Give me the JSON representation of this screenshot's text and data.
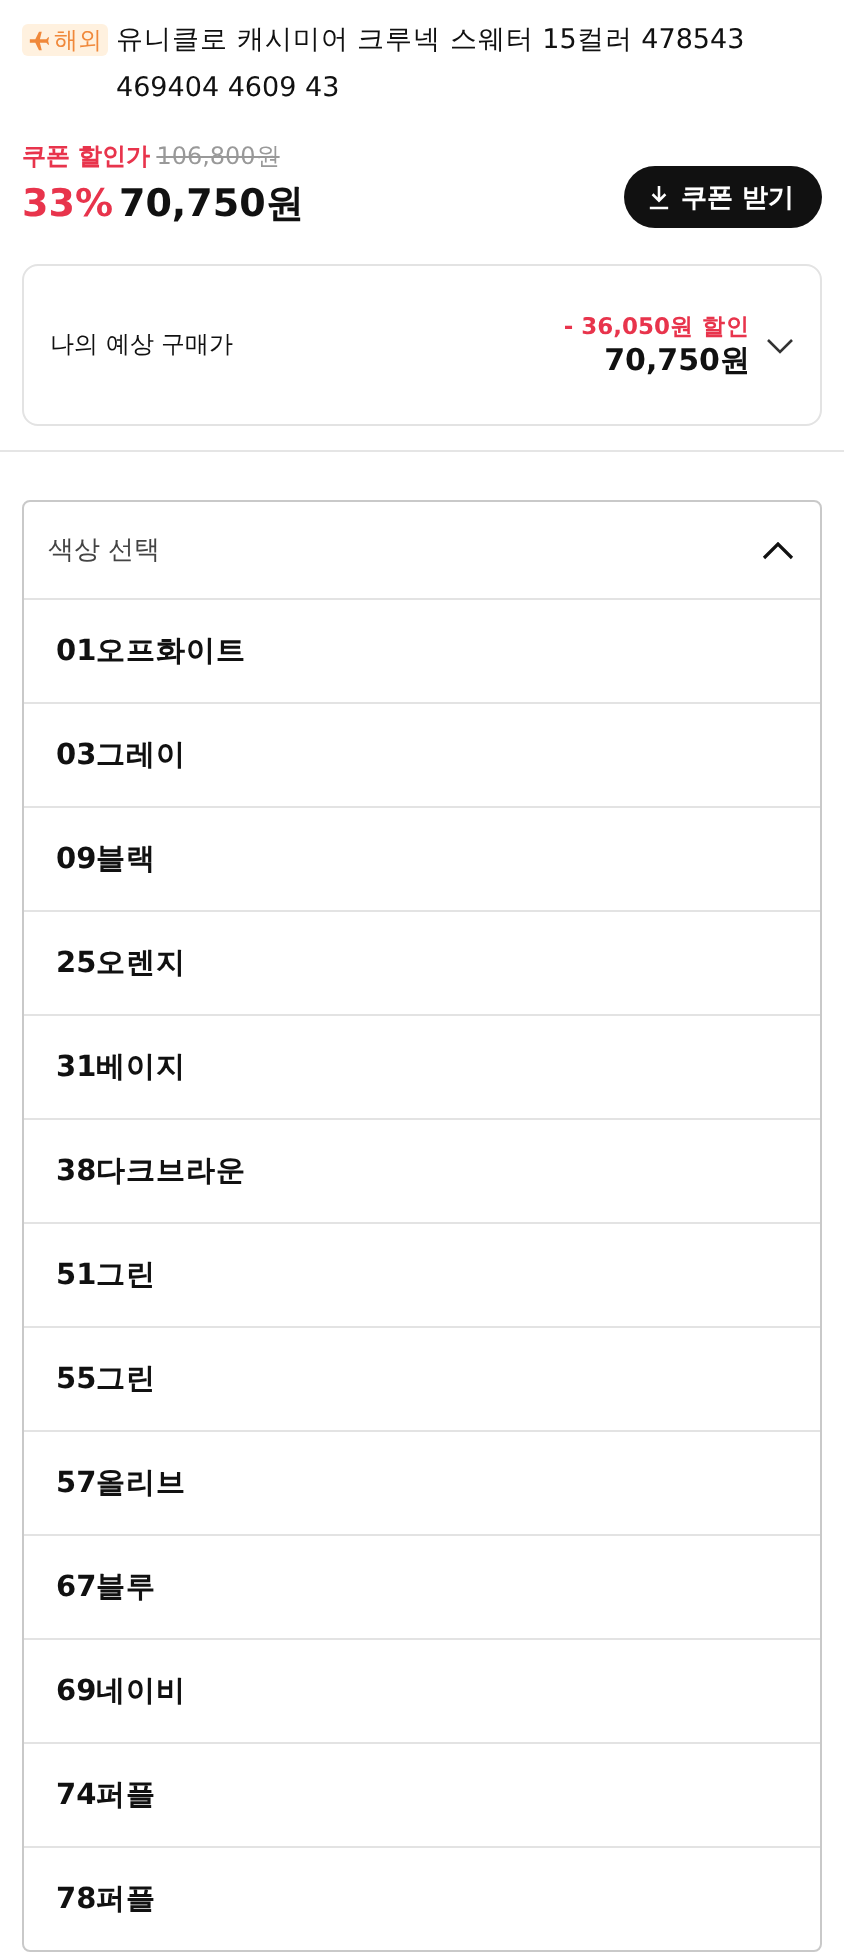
{
  "product": {
    "badge": "해외",
    "title": "유니클로 캐시미어 크루넥 스웨터 15컬러 478543 469404 4609 43"
  },
  "price": {
    "coupon_label": "쿠폰 할인가",
    "original": "106,800원",
    "discount": "33%",
    "final": "70,750원",
    "coupon_button": "쿠폰 받기"
  },
  "estimate": {
    "label": "나의 예상 구매가",
    "discount": "- 36,050원 할인",
    "price": "70,750원",
    "expanded": false
  },
  "color_select": {
    "label": "색상 선택",
    "expanded": true,
    "options": [
      {
        "label": "01오프화이트"
      },
      {
        "label": "03그레이"
      },
      {
        "label": "09블랙"
      },
      {
        "label": "25오렌지"
      },
      {
        "label": "31베이지"
      },
      {
        "label": "38다크브라운"
      },
      {
        "label": "51그린"
      },
      {
        "label": "55그린"
      },
      {
        "label": "57올리브"
      },
      {
        "label": "67블루"
      },
      {
        "label": "69네이비"
      },
      {
        "label": "74퍼플"
      },
      {
        "label": "78퍼플"
      }
    ]
  }
}
